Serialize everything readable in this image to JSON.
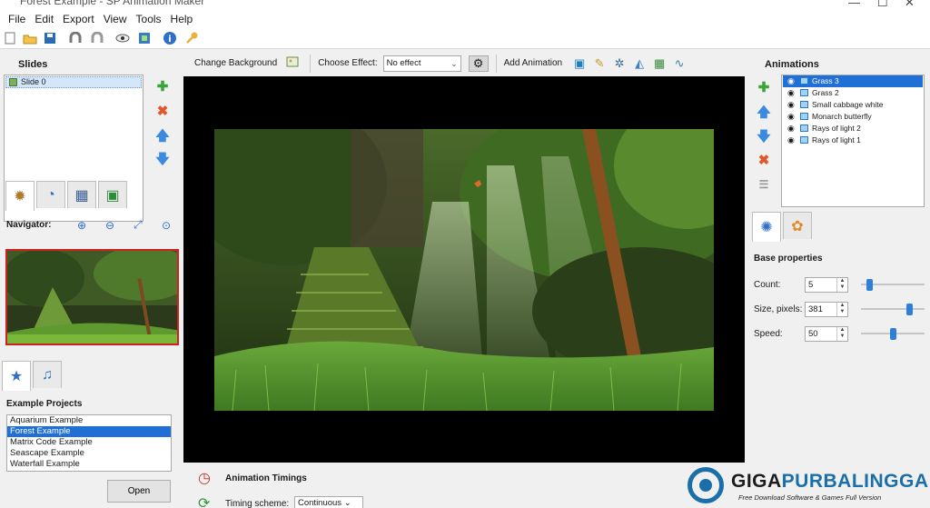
{
  "window": {
    "title": "Forest Example - SP Animation Maker"
  },
  "menu": {
    "items": [
      "File",
      "Edit",
      "Export",
      "View",
      "Tools",
      "Help"
    ]
  },
  "slides": {
    "title": "Slides",
    "items": [
      "Slide 0"
    ]
  },
  "navigator": {
    "label": "Navigator:"
  },
  "examples": {
    "title": "Example Projects",
    "items": [
      "Aquarium Example",
      "Forest Example",
      "Matrix Code Example",
      "Seascape Example",
      "Waterfall Example"
    ],
    "selected": "Forest Example",
    "open_label": "Open"
  },
  "center_toolbar": {
    "change_background": "Change Background",
    "choose_effect": "Choose Effect:",
    "effect_value": "No effect",
    "add_animation": "Add Animation"
  },
  "timings": {
    "title": "Animation Timings",
    "scheme_label": "Timing scheme:",
    "scheme_value": "Continuous"
  },
  "animations": {
    "title": "Animations",
    "items": [
      "Grass 3",
      "Grass 2",
      "Small cabbage white",
      "Monarch butterfly",
      "Rays of light 2",
      "Rays of light 1"
    ],
    "selected": "Grass 3"
  },
  "properties": {
    "title": "Base properties",
    "rows": [
      {
        "label": "Count:",
        "value": "5",
        "slider": 0.1
      },
      {
        "label": "Size, pixels:",
        "value": "381",
        "slider": 0.8
      },
      {
        "label": "Speed:",
        "value": "50",
        "slider": 0.5
      }
    ]
  },
  "watermark": {
    "name_part1": "GIGA",
    "name_part2": "PURBALINGGA",
    "tagline": "Free Download Software & Games Full Version"
  },
  "colors": {
    "selection": "#1f6fd6",
    "accent": "#1b6fa8",
    "preview_border": "#d02020"
  }
}
